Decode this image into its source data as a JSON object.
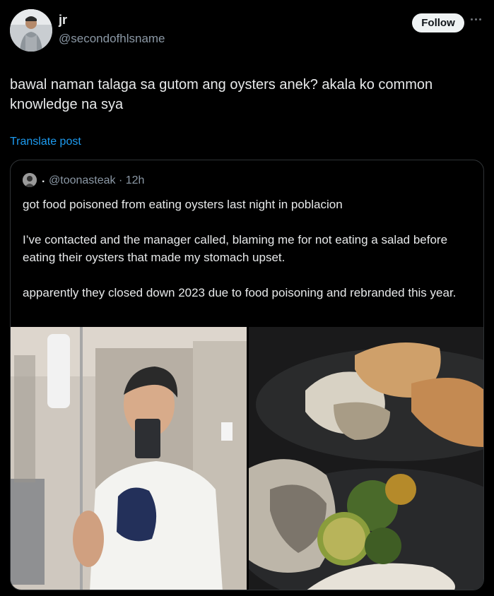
{
  "author": {
    "name": "jr",
    "handle": "@secondofhlsname"
  },
  "actions": {
    "follow_label": "Follow"
  },
  "post": {
    "text": "bawal naman talaga sa gutom ang oysters anek? akala ko common knowledge na sya",
    "translate_label": "Translate post"
  },
  "quoted": {
    "name": ".",
    "handle_time": "@toonasteak · 12h",
    "paragraphs": [
      "got food poisoned from eating oysters last night in poblacion",
      "I’ve contacted and the manager called, blaming me for not eating a salad before eating their oysters that made my stomach upset.",
      "apparently they closed down 2023 due to food poisoning and rebranded this year."
    ]
  },
  "colors": {
    "background": "#000000",
    "text": "#e7e9ea",
    "muted": "#8b98a5",
    "link": "#1d9bf0",
    "border": "#2f3336"
  },
  "icons": [
    "more-icon"
  ]
}
